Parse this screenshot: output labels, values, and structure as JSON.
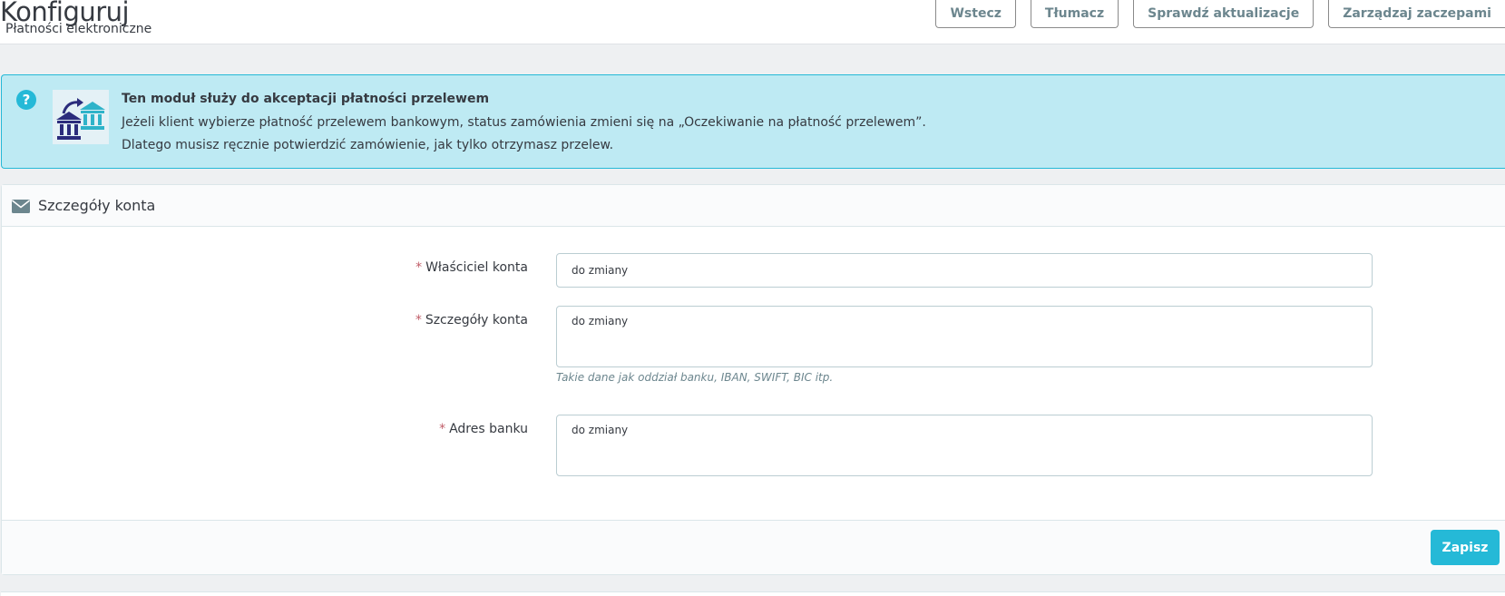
{
  "header": {
    "title": "Konfiguruj",
    "subtitle": "Płatności elektroniczne",
    "toolbar": {
      "back": "Wstecz",
      "translate": "Tłumacz",
      "check_updates": "Sprawdź aktualizacje",
      "manage_hooks": "Zarządzaj zaczepami"
    }
  },
  "alert": {
    "help_icon": "?",
    "logo_icon": "bank-transfer-icon",
    "title": "Ten moduł służy do akceptacji płatności przelewem",
    "line1": "Jeżeli klient wybierze płatność przelewem bankowym, status zamówienia zmieni się na „Oczekiwanie na płatność przelewem”.",
    "line2": "Dlatego musisz ręcznie potwierdzić zamówienie, jak tylko otrzymasz przelew."
  },
  "panel": {
    "heading_icon": "envelope-icon",
    "heading": "Szczegóły konta",
    "required_mark": "*",
    "fields": {
      "owner": {
        "label": "Właściciel konta",
        "value": "do zmiany"
      },
      "details": {
        "label": "Szczegóły konta",
        "value": "do zmiany",
        "help": "Takie dane jak oddział banku, IBAN, SWIFT, BIC itp."
      },
      "address": {
        "label": "Adres banku",
        "value": "do zmiany"
      }
    },
    "save": "Zapisz"
  },
  "colors": {
    "accent": "#25b9d7",
    "alert_bg": "#beeaf3",
    "required": "#c05c67",
    "text": "#363a41",
    "muted": "#6c868e"
  }
}
